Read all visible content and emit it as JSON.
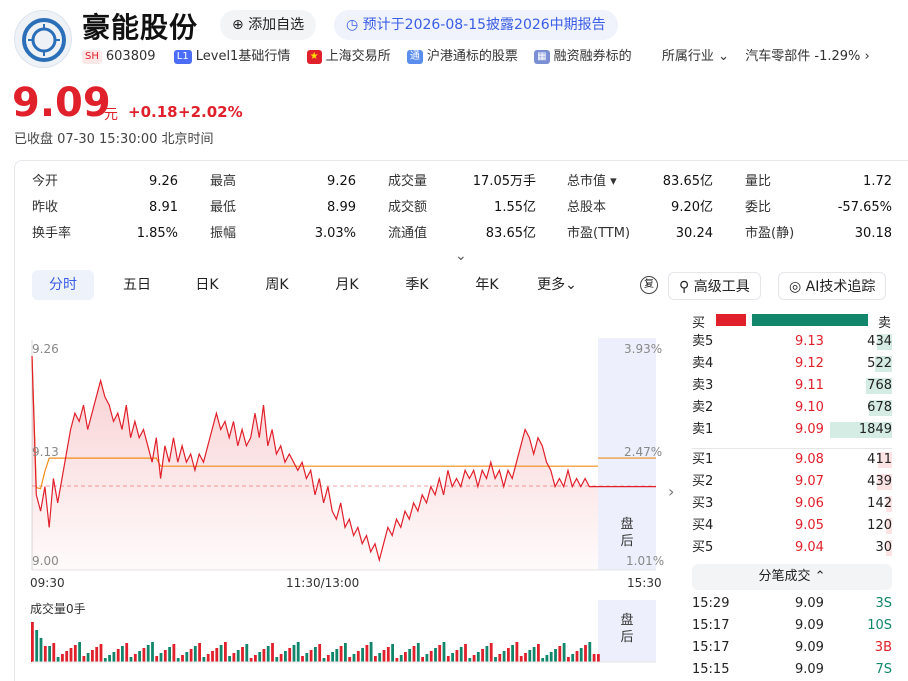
{
  "header": {
    "name": "豪能股份",
    "add_watchlist": "添加自选",
    "notice": "预计于2026-08-15披露2026中期报告",
    "exchange_badge": "SH",
    "code": "603809",
    "level1": "Level1基础行情",
    "market": "上海交易所",
    "hk_connect": "沪港通标的股票",
    "margin": "融资融券标的",
    "industry_label": "所属行业",
    "industry_value": "汽车零部件 -1.29%"
  },
  "quote": {
    "price": "9.09",
    "unit": "元",
    "change": "+0.18",
    "change_pct": "+2.02%",
    "status": "已收盘 07-30 15:30:00 北京时间"
  },
  "stats": [
    [
      {
        "k": "今开",
        "v": "9.26",
        "c": "red"
      },
      {
        "k": "最高",
        "v": "9.26",
        "c": "red"
      },
      {
        "k": "成交量",
        "v": "17.05万手",
        "c": ""
      },
      {
        "k": "总市值 ▾",
        "v": "83.65亿",
        "c": ""
      },
      {
        "k": "量比",
        "v": "1.72",
        "c": "red"
      }
    ],
    [
      {
        "k": "昨收",
        "v": "8.91",
        "c": ""
      },
      {
        "k": "最低",
        "v": "8.99",
        "c": "red"
      },
      {
        "k": "成交额",
        "v": "1.55亿",
        "c": ""
      },
      {
        "k": "总股本",
        "v": "9.20亿",
        "c": ""
      },
      {
        "k": "委比",
        "v": "-57.65%",
        "c": ""
      }
    ],
    [
      {
        "k": "换手率",
        "v": "1.85%",
        "c": ""
      },
      {
        "k": "振幅",
        "v": "3.03%",
        "c": ""
      },
      {
        "k": "流通值",
        "v": "83.65亿",
        "c": ""
      },
      {
        "k": "市盈(TTM)",
        "v": "30.24",
        "c": ""
      },
      {
        "k": "市盈(静)",
        "v": "30.18",
        "c": ""
      }
    ]
  ],
  "tabs": [
    "分时",
    "五日",
    "日K",
    "周K",
    "月K",
    "季K",
    "年K",
    "更多"
  ],
  "tools": {
    "advanced": "高级工具",
    "ai": "AI技术追踪"
  },
  "chart": {
    "price_high": "9.26",
    "price_mid": "9.13",
    "price_low": "9.00",
    "pct_high": "3.93%",
    "pct_mid": "2.47%",
    "pct_low": "1.01%",
    "time_start": "09:30",
    "time_mid": "11:30/13:00",
    "time_end": "15:30",
    "after_hours": "盘后",
    "volume_label": "成交量0手",
    "prev_close": 8.91,
    "avg_level": 9.115,
    "price_series": [
      9.25,
      9.08,
      9.06,
      9.09,
      9.04,
      9.1,
      9.07,
      9.1,
      9.13,
      9.16,
      9.18,
      9.17,
      9.19,
      9.16,
      9.18,
      9.2,
      9.22,
      9.2,
      9.19,
      9.17,
      9.18,
      9.16,
      9.19,
      9.15,
      9.17,
      9.15,
      9.16,
      9.14,
      9.12,
      9.15,
      9.1,
      9.14,
      9.12,
      9.15,
      9.12,
      9.14,
      9.12,
      9.13,
      9.11,
      9.13,
      9.12,
      9.14,
      9.16,
      9.18,
      9.16,
      9.17,
      9.15,
      9.17,
      9.14,
      9.16,
      9.14,
      9.15,
      9.18,
      9.15,
      9.19,
      9.14,
      9.16,
      9.13,
      9.14,
      9.12,
      9.13,
      9.12,
      9.11,
      9.12,
      9.1,
      9.11,
      9.08,
      9.1,
      9.07,
      9.09,
      9.06,
      9.05,
      9.07,
      9.04,
      9.05,
      9.03,
      9.04,
      9.02,
      9.03,
      9.01,
      9.02,
      9.0,
      9.02,
      9.04,
      9.03,
      9.05,
      9.04,
      9.06,
      9.05,
      9.07,
      9.06,
      9.08,
      9.07,
      9.09,
      9.08,
      9.1,
      9.08,
      9.11,
      9.09,
      9.1,
      9.09,
      9.11,
      9.1,
      9.11,
      9.09,
      9.11,
      9.1,
      9.12,
      9.1,
      9.11,
      9.09,
      9.11,
      9.1,
      9.12,
      9.14,
      9.16,
      9.15,
      9.13,
      9.15,
      9.14,
      9.12,
      9.11,
      9.09,
      9.1,
      9.09,
      9.11,
      9.09,
      9.1,
      9.09,
      9.1,
      9.09,
      9.09,
      9.09
    ]
  },
  "orderbook": {
    "buy_label": "买",
    "sell_label": "卖",
    "asks": [
      {
        "l": "卖5",
        "p": "9.13",
        "v": "434"
      },
      {
        "l": "卖4",
        "p": "9.12",
        "v": "522"
      },
      {
        "l": "卖3",
        "p": "9.11",
        "v": "768"
      },
      {
        "l": "卖2",
        "p": "9.10",
        "v": "678"
      },
      {
        "l": "卖1",
        "p": "9.09",
        "v": "1849"
      }
    ],
    "bids": [
      {
        "l": "买1",
        "p": "9.08",
        "v": "411"
      },
      {
        "l": "买2",
        "p": "9.07",
        "v": "439"
      },
      {
        "l": "买3",
        "p": "9.06",
        "v": "142"
      },
      {
        "l": "买4",
        "p": "9.05",
        "v": "120"
      },
      {
        "l": "买5",
        "p": "9.04",
        "v": "30"
      }
    ]
  },
  "trades": {
    "title": "分笔成交",
    "rows": [
      {
        "t": "15:29",
        "p": "9.09",
        "v": "3S"
      },
      {
        "t": "15:17",
        "p": "9.09",
        "v": "10S"
      },
      {
        "t": "15:17",
        "p": "9.09",
        "v": "3B"
      },
      {
        "t": "15:15",
        "p": "9.09",
        "v": "7S"
      }
    ]
  }
}
